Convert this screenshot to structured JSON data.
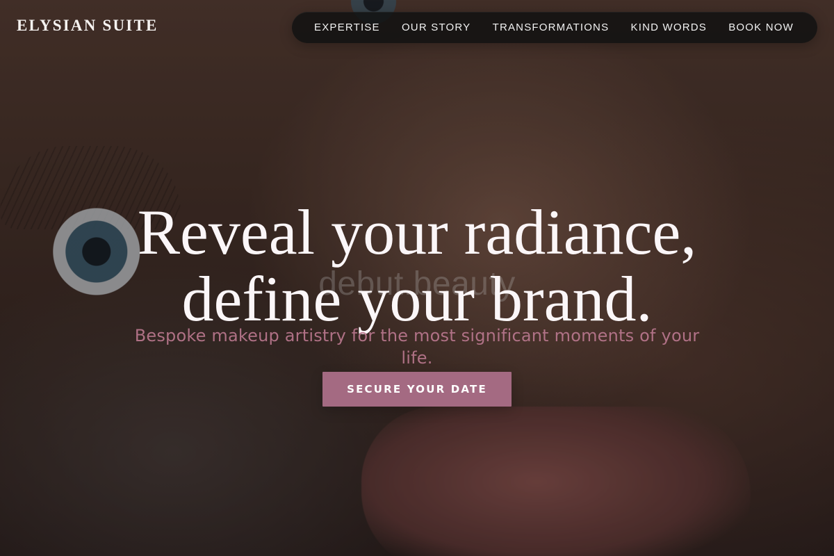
{
  "brand": {
    "name": "ELYSIAN SUITE"
  },
  "nav": {
    "items": [
      {
        "label": "EXPERTISE"
      },
      {
        "label": "OUR STORY"
      },
      {
        "label": "TRANSFORMATIONS"
      },
      {
        "label": "KIND WORDS"
      },
      {
        "label": "BOOK NOW"
      }
    ]
  },
  "hero": {
    "headline_line1": "Reveal your radiance,",
    "headline_line2": "define your brand.",
    "subheadline": "Bespoke makeup artistry for the most significant moments of your life.",
    "cta_label": "SECURE YOUR DATE",
    "watermark": "debut.beauty"
  },
  "theme": {
    "accent": "#A46A82",
    "nav_bg": "#121212"
  },
  "icons": {
    "hero_image": "makeup-portrait-image"
  }
}
